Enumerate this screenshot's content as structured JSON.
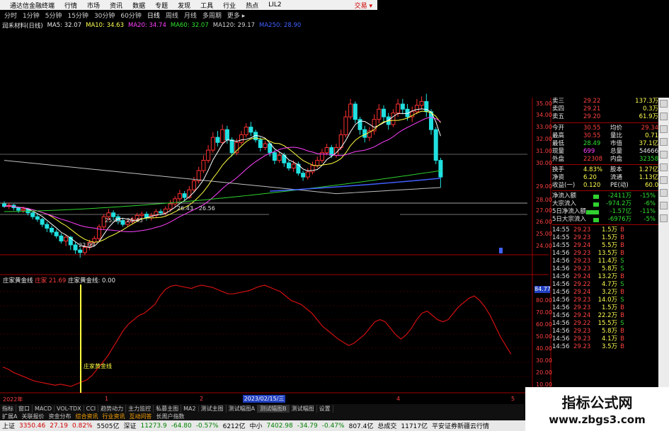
{
  "titlebar": {
    "app": "通达信金融终端",
    "menus": [
      "行情",
      "市场",
      "资讯",
      "数据",
      "专题",
      "发现",
      "工具",
      "行业",
      "热点",
      "LIL2"
    ],
    "trade": "交易 ▾"
  },
  "periods": [
    "分时",
    "1分钟",
    "5分钟",
    "15分钟",
    "30分钟",
    "60分钟",
    "日线",
    "周线",
    "月线",
    "多周期",
    "更多 ▸"
  ],
  "ma_legend": {
    "name": "润禾材料(日线)",
    "ma5": "MA5: 32.07",
    "ma10": "MA10: 34.63",
    "ma20": "MA20: 34.74",
    "ma60": "MA60: 32.07",
    "ma120": "MA120: 29.17",
    "ma250": "MA250: 28.90"
  },
  "price_axis": [
    "35.00",
    "34.00",
    "33.00",
    "32.00",
    "31.00",
    "30.00",
    "29.00",
    "28.00",
    "27.00",
    "26.00",
    "25.00",
    "24.00"
  ],
  "price_annotations": {
    "low1": "22.99",
    "mid1": "25.43",
    "mid2": "25.45",
    "mid3": "26.43",
    "mid4": "26.56"
  },
  "indicator_legend": {
    "name": "庄家黄金线",
    "tag": "庄家",
    "val1": "21.69",
    "name2": "庄家黄金线: 0.00"
  },
  "indicator_axis": [
    "84.77",
    "80.00",
    "70.00",
    "60.00",
    "50.00",
    "40.00",
    "30.00",
    "20.00",
    "10.00"
  ],
  "indicator_marker_label": "庄家黄金线",
  "time_axis": {
    "year": "2022年",
    "m1": "1",
    "m2": "2",
    "date": "2023/02/15/三",
    "m4": "4",
    "m5": "5"
  },
  "quote": {
    "asks": [
      {
        "label": "卖三",
        "price": "29.22",
        "vol": "137.3万"
      },
      {
        "label": "卖四",
        "price": "29.21",
        "vol": "0.3万"
      },
      {
        "label": "卖五",
        "price": "29.20",
        "vol": "61.9万"
      }
    ],
    "stats": [
      {
        "k1": "今开",
        "v1": "30.55",
        "k2": "均价",
        "v2": "29.34"
      },
      {
        "k1": "最高",
        "v1": "30.55",
        "k2": "量比",
        "v2": "0.71"
      },
      {
        "k1": "最低",
        "v1": "28.49",
        "k2": "市值",
        "v2": "37.1亿"
      },
      {
        "k1": "现量",
        "v1": "699",
        "k2": "总量",
        "v2": "54666"
      },
      {
        "k1": "外盘",
        "v1": "22308",
        "k2": "内盘",
        "v2": "32358"
      },
      {
        "k1": "换手",
        "v1": "4.83%",
        "k2": "股本",
        "v2": "1.27亿"
      },
      {
        "k1": "净资",
        "v1": "6.20",
        "k2": "流通",
        "v2": "1.13亿"
      },
      {
        "k1": "收益(一)",
        "v1": "0.120",
        "k2": "PE(动)",
        "v2": "60.0"
      }
    ],
    "flows": [
      {
        "label": "净流入额",
        "value": "-2411万",
        "pct": "-15%"
      },
      {
        "label": "大宗流入",
        "value": "-974.2万",
        "pct": "-6%"
      },
      {
        "label": "5日净流入额",
        "value": "-1.57亿",
        "pct": "-11%"
      },
      {
        "label": "5日大宗流入",
        "value": "-6976万",
        "pct": "-5%"
      }
    ],
    "ticks": [
      {
        "t": "14:55",
        "p": "29.23",
        "v": "1.5万",
        "d": "B"
      },
      {
        "t": "14:55",
        "p": "29.23",
        "v": "1.5万",
        "d": "B"
      },
      {
        "t": "14:55",
        "p": "29.24",
        "v": "5.5万",
        "d": "B"
      },
      {
        "t": "14:56",
        "p": "29.23",
        "v": "13.5万",
        "d": "B"
      },
      {
        "t": "14:56",
        "p": "29.23",
        "v": "11.4万",
        "d": "S"
      },
      {
        "t": "14:56",
        "p": "29.23",
        "v": "5.8万",
        "d": "S"
      },
      {
        "t": "14:56",
        "p": "29.24",
        "v": "13.2万",
        "d": "B"
      },
      {
        "t": "14:56",
        "p": "29.22",
        "v": "4.7万",
        "d": "S"
      },
      {
        "t": "14:56",
        "p": "29.24",
        "v": "3.2万",
        "d": "B"
      },
      {
        "t": "14:56",
        "p": "29.23",
        "v": "14.0万",
        "d": "S"
      },
      {
        "t": "14:56",
        "p": "29.23",
        "v": "1.5万",
        "d": "B"
      },
      {
        "t": "14:56",
        "p": "29.24",
        "v": "22.2万",
        "d": "B"
      },
      {
        "t": "14:56",
        "p": "29.22",
        "v": "15.5万",
        "d": "S"
      },
      {
        "t": "14:56",
        "p": "29.23",
        "v": "5.8万",
        "d": "B"
      },
      {
        "t": "14:56",
        "p": "29.23",
        "v": "4.1万",
        "d": "B"
      },
      {
        "t": "14:56",
        "p": "29.23",
        "v": "3.5万",
        "d": "B"
      }
    ]
  },
  "tabs": [
    "指标",
    "窗口",
    "MACD",
    "VOL-TDX",
    "CCI",
    "趋势动力",
    "主力监控",
    "私募主图",
    "MA2",
    "测试主图",
    "测试幅图A",
    "测试幅图B",
    "测试幅图",
    "设置"
  ],
  "toolbar2": [
    "扩展A",
    "关联报价",
    "资金分布",
    "综合资讯",
    "行业资讯",
    "互动问答",
    "长周户指数"
  ],
  "statusbar": {
    "sh_label": "上证",
    "sh_val": "3350.46",
    "sh_chg": "27.19",
    "sh_pct": "0.82%",
    "sh_amt": "5505亿",
    "sz_label": "深证",
    "sz_val": "11273.9",
    "sz_chg": "-64.80",
    "sz_pct": "-0.57%",
    "sz_amt": "6212亿",
    "zx_label": "中小",
    "zx_val": "7402.98",
    "zx_chg": "-34.79",
    "zx_pct": "-0.47%",
    "zx_amt": "807.4亿",
    "total_label": "总成交",
    "total_val": "11717亿",
    "broker": "平安证券新疆云行情"
  },
  "watermark": {
    "line1": "指标公式网",
    "line2": "www.zbgs3.com"
  },
  "colors": {
    "up": "#ff3030",
    "down": "#20e0e0",
    "ma5": "#ffffff",
    "ma10": "#ffff40",
    "ma20": "#ff40ff",
    "ma60": "#30d030",
    "ma120": "#c0c0c0",
    "ma250": "#4060ff",
    "indicator": "#d01010"
  }
}
